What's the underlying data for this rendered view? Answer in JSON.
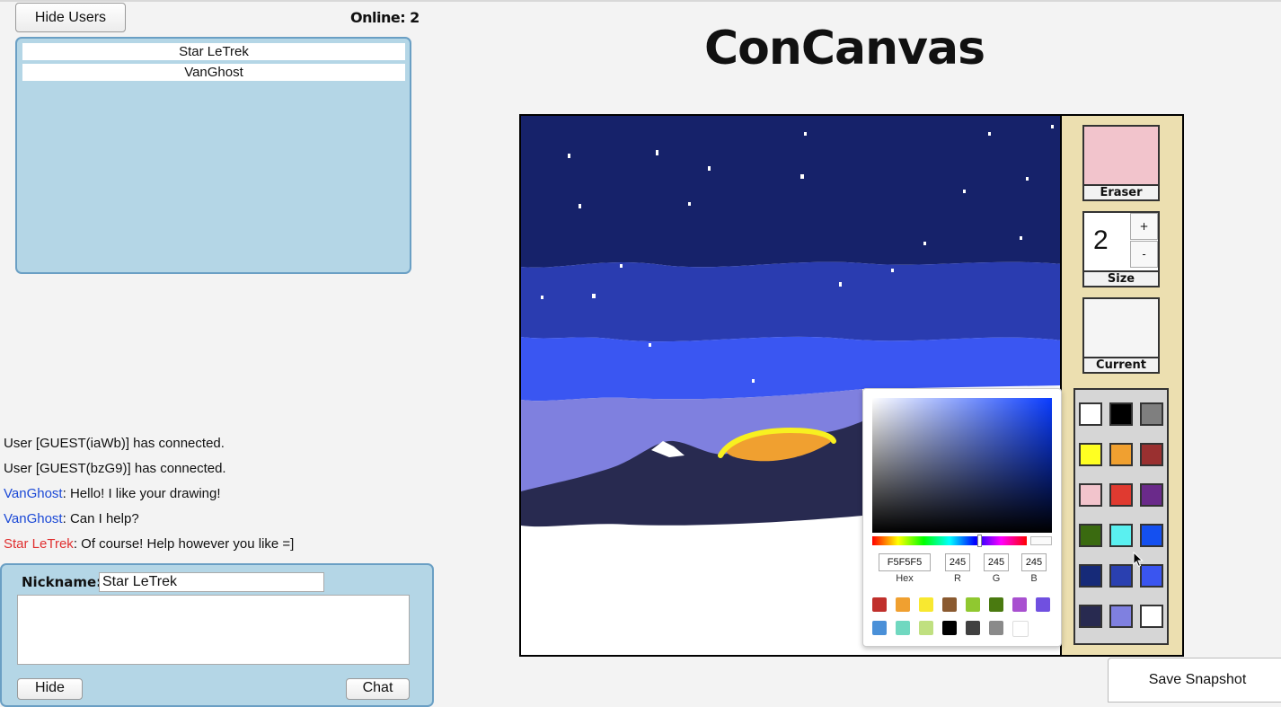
{
  "header": {
    "title": "ConCanvas",
    "hide_users_label": "Hide Users",
    "online_label": "Online: 2"
  },
  "users": [
    "Star LeTrek",
    "VanGhost"
  ],
  "messages": [
    {
      "nick": "",
      "text": "User [GUEST(iaWb)] has connected.",
      "nick_color": ""
    },
    {
      "nick": "",
      "text": "User [GUEST(bzG9)] has connected.",
      "nick_color": ""
    },
    {
      "nick": "VanGhost",
      "text": ": Hello! I like your drawing!",
      "nick_color": "#1a48d6"
    },
    {
      "nick": "VanGhost",
      "text": ": Can I help?",
      "nick_color": "#1a48d6"
    },
    {
      "nick": "Star LeTrek",
      "text": ": Of course! Help however you like =]",
      "nick_color": "#e03030"
    }
  ],
  "chat": {
    "nickname_label": "Nickname:",
    "nickname_value": "Star LeTrek",
    "message_value": "",
    "hide_label": "Hide",
    "send_label": "Chat"
  },
  "tools": {
    "eraser_label": "Eraser",
    "eraser_color": "#f2c4cc",
    "size_value": "2",
    "size_plus": "+",
    "size_minus": "-",
    "size_label": "Size",
    "current_label": "Current",
    "current_color": "#f5f5f5"
  },
  "palette": [
    "#ffffff",
    "#000000",
    "#7f7f7f",
    "#ffff22",
    "#f0a030",
    "#9a3030",
    "#f2c4cc",
    "#e03a30",
    "#6a2a8a",
    "#3a6a10",
    "#5af0f0",
    "#1450f0",
    "#162a78",
    "#2a40b0",
    "#3a55f0",
    "#282a50",
    "#7f80e0",
    "#ffffff"
  ],
  "color_picker": {
    "hex_value": "F5F5F5",
    "r_value": "245",
    "g_value": "245",
    "b_value": "245",
    "hex_label": "Hex",
    "r_label": "R",
    "g_label": "G",
    "b_label": "B",
    "presets": [
      "#c0302c",
      "#f0a030",
      "#f8e830",
      "#8a5a30",
      "#90c830",
      "#4a7a10",
      "#a850d0",
      "#7050e0",
      "#4a90d8",
      "#70d8c0",
      "#c0e080",
      "#000000",
      "#404040",
      "#8a8a8a",
      "#ffffff"
    ]
  },
  "save_label": "Save Snapshot"
}
